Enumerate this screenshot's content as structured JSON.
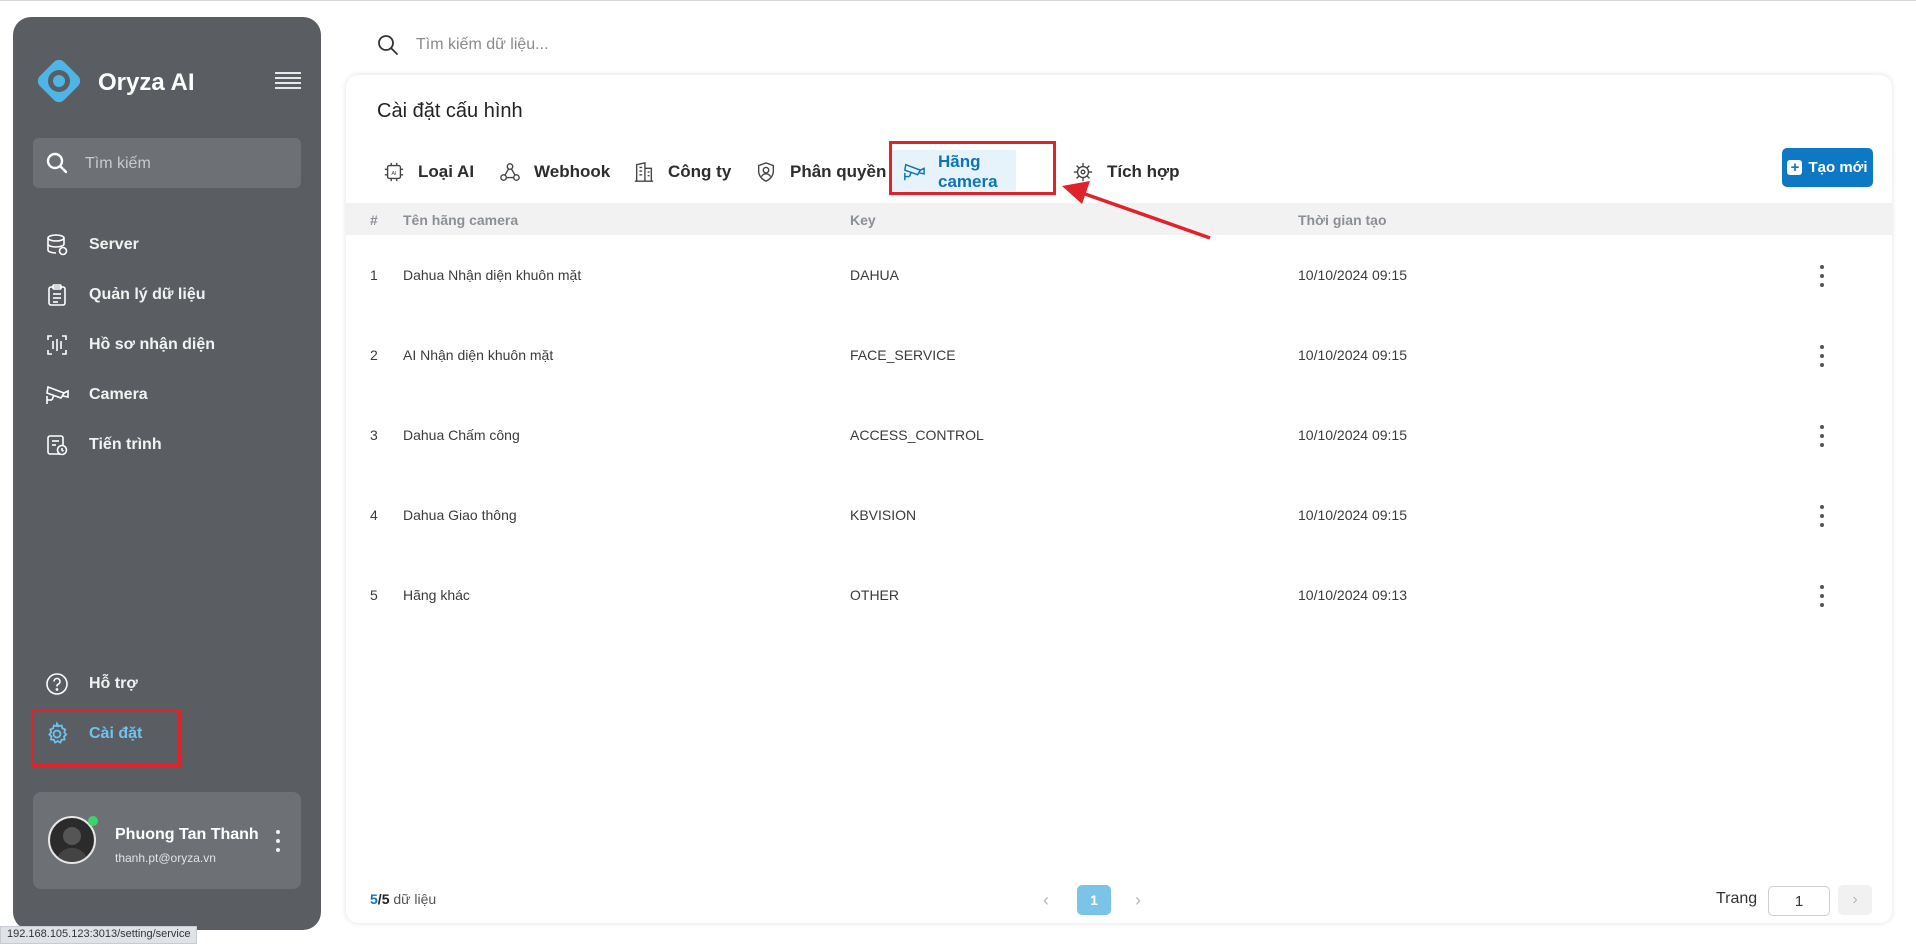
{
  "sidebar": {
    "brand": "Oryza AI",
    "search_placeholder": "Tìm kiếm",
    "items": [
      {
        "label": "Server"
      },
      {
        "label": "Quản lý dữ liệu"
      },
      {
        "label": "Hồ sơ nhận diện"
      },
      {
        "label": "Camera"
      },
      {
        "label": "Tiến trình"
      }
    ],
    "bottom_items": [
      {
        "label": "Hỗ trợ"
      },
      {
        "label": "Cài đặt"
      }
    ],
    "user": {
      "name": "Phuong Tan Thanh",
      "email": "thanh.pt@oryza.vn"
    }
  },
  "top_search_placeholder": "Tìm kiếm dữ liệu...",
  "page": {
    "title": "Cài đặt cấu hình",
    "tabs": [
      {
        "label": "Loại AI"
      },
      {
        "label": "Webhook"
      },
      {
        "label": "Công ty"
      },
      {
        "label": "Phân quyền"
      },
      {
        "label": "Hãng camera"
      },
      {
        "label": "Tích hợp"
      }
    ],
    "active_tab": "Hãng camera",
    "new_button": "Tạo mới",
    "table": {
      "columns": [
        "#",
        "Tên hãng camera",
        "Key",
        "Thời gian tạo"
      ],
      "rows": [
        [
          "1",
          "Dahua Nhận diện khuôn mặt",
          "DAHUA",
          "10/10/2024 09:15"
        ],
        [
          "2",
          "AI Nhận diện khuôn mặt",
          "FACE_SERVICE",
          "10/10/2024 09:15"
        ],
        [
          "3",
          "Dahua Chấm công",
          "ACCESS_CONTROL",
          "10/10/2024 09:15"
        ],
        [
          "4",
          "Dahua Giao thông",
          "KBVISION",
          "10/10/2024 09:15"
        ],
        [
          "5",
          "Hãng khác",
          "OTHER",
          "10/10/2024 09:13"
        ]
      ]
    },
    "footer": {
      "count_shown": "5",
      "count_total": "5",
      "count_suffix": " dữ liệu",
      "current_page": "1",
      "page_label": "Trang",
      "page_input": "1"
    }
  },
  "status_url": "192.168.105.123:3013/setting/service",
  "colors": {
    "accent": "#0d79c4",
    "sidebar": "#5a5e63",
    "highlight": "#e0222a",
    "active_nav": "#6ec3f0"
  }
}
